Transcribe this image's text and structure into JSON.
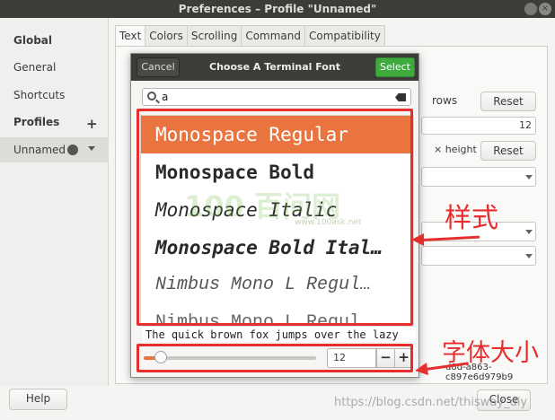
{
  "window": {
    "title": "Preferences – Profile \"Unnamed\""
  },
  "sidebar": {
    "global": "Global",
    "general": "General",
    "shortcuts": "Shortcuts",
    "profiles": "Profiles",
    "add": "+",
    "profile_name": "Unnamed"
  },
  "tabs": [
    "Text",
    "Colors",
    "Scrolling",
    "Command",
    "Compatibility"
  ],
  "panel": {
    "rows_label": "rows",
    "reset": "Reset",
    "size_value": "12",
    "height_label": "× height",
    "uuid": "d8d-a863-c897e6d979b9"
  },
  "footer": {
    "help": "Help",
    "close": "Close"
  },
  "dialog": {
    "cancel": "Cancel",
    "title": "Choose A Terminal Font",
    "select": "Select",
    "search_value": "a",
    "fonts": [
      "Monospace Regular",
      "Monospace Bold",
      "Monospace Italic",
      "Monospace Bold Ital…",
      "Nimbus Mono L Regul…",
      "Nimbus Mono L Regul"
    ],
    "preview": "The quick brown fox jumps over the lazy",
    "size": "12",
    "minus": "−",
    "plus": "+",
    "slider_fraction": 0.1
  },
  "annotations": {
    "style_label": "样式",
    "size_label": "字体大小",
    "accent_color": "#e62e2e"
  },
  "watermarks": {
    "logo": "100 百问网",
    "site": "www.100ask.net",
    "csdn": "https://blog.csdn.net/thisway_diy"
  },
  "colors": {
    "selection": "#e9743f",
    "select_button": "#3fab3f",
    "titlebar": "#3d3c38"
  }
}
